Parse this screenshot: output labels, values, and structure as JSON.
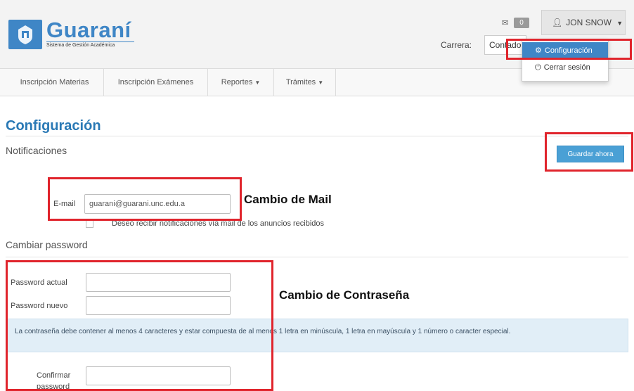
{
  "header": {
    "logo_title": "Guaraní",
    "logo_subtitle": "Sistema de Gestión Académica",
    "messages_count": "0",
    "user_name": "JON SNOW",
    "carrera_label": "Carrera:",
    "carrera_value": "Contador"
  },
  "user_dropdown": {
    "items": [
      {
        "label": "Configuración",
        "icon": "gear-icon"
      },
      {
        "label": "Cerrar sesión",
        "icon": "power-icon"
      }
    ]
  },
  "nav": {
    "items": [
      {
        "label": "Inscripción Materias"
      },
      {
        "label": "Inscripción Exámenes"
      },
      {
        "label": "Reportes"
      },
      {
        "label": "Trámites"
      }
    ]
  },
  "page": {
    "title": "Configuración",
    "notificaciones_title": "Notificaciones",
    "save_button": "Guardar ahora",
    "email_label": "E-mail",
    "email_value": "guarani@guarani.unc.edu.a",
    "checkbox_label": "Deseo recibir notificaciones vía mail de los anuncios recibidos",
    "password_section_title": "Cambiar password",
    "password_actual_label": "Password actual",
    "password_nuevo_label": "Password nuevo",
    "password_info": "La contraseña debe contener al menos 4 caracteres y estar compuesta de al menos 1 letra en minúscula, 1 letra en mayúscula y 1 número o caracter especial.",
    "confirmar_label_1": "Confirmar",
    "confirmar_label_2": "password"
  },
  "annotations": {
    "mail_change": "Cambio de Mail",
    "password_change": "Cambio de Contraseña"
  },
  "colors": {
    "brand_blue": "#3f86c6",
    "highlight_red": "#e0242c",
    "info_bg": "#e1eef7"
  }
}
